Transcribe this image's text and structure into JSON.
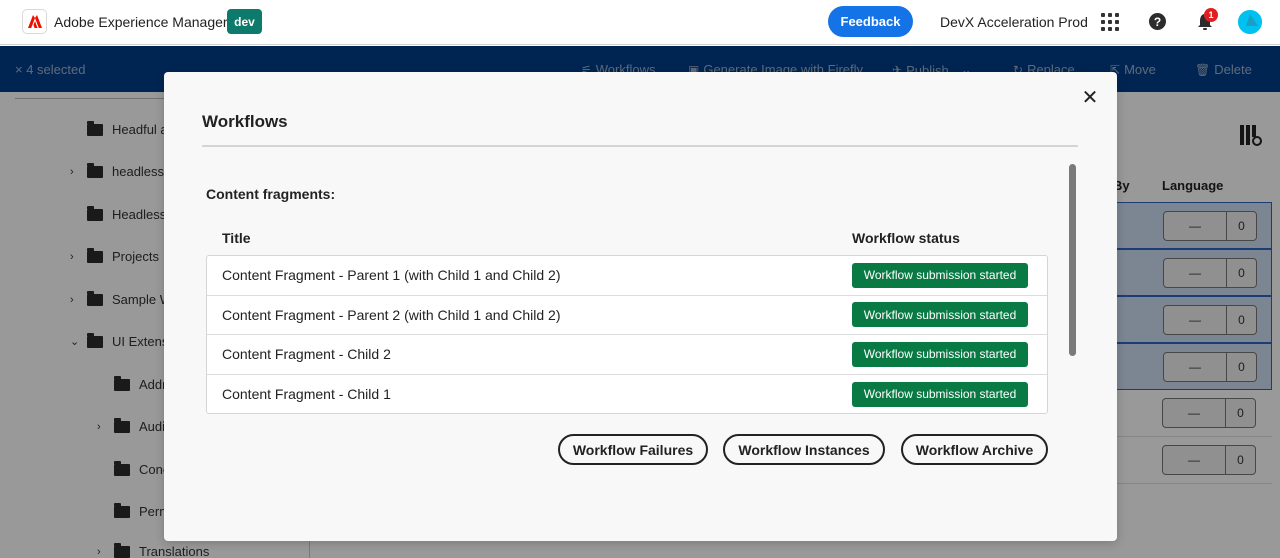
{
  "header": {
    "app_title": "Adobe Experience Manager",
    "env_badge": "dev",
    "feedback_label": "Feedback",
    "org_name": "DevX Acceleration Prod",
    "notification_count": "1",
    "help_glyph": "?"
  },
  "actionbar": {
    "selection_label": "× 4 selected",
    "actions": [
      {
        "label": "Workflows",
        "icon": "workflow-icon",
        "glyph": "⚟"
      },
      {
        "label": "Generate Image with Firefly",
        "icon": "image-icon",
        "glyph": "▣"
      },
      {
        "label": "Publish",
        "icon": "publish-icon",
        "glyph": "✈",
        "dropdown": "⌄"
      },
      {
        "label": "Replace",
        "icon": "replace-icon",
        "glyph": "↻"
      },
      {
        "label": "Move",
        "icon": "move-icon",
        "glyph": "⇱"
      },
      {
        "label": "Delete",
        "icon": "trash-icon",
        "glyph": "🗑"
      }
    ]
  },
  "sidebar": {
    "items": [
      {
        "label": "Headful a",
        "expandable": false
      },
      {
        "label": "headless",
        "expandable": true,
        "chevron": "›"
      },
      {
        "label": "Headless",
        "expandable": false
      },
      {
        "label": "Projects",
        "expandable": true,
        "chevron": "›"
      },
      {
        "label": "Sample W",
        "expandable": true,
        "chevron": "›"
      },
      {
        "label": "UI Extens",
        "expandable": true,
        "expanded": true,
        "chevron": "⌄"
      },
      {
        "label": "Addr",
        "expandable": false
      },
      {
        "label": "Audi",
        "expandable": true,
        "chevron": "›"
      },
      {
        "label": "Conc",
        "expandable": false
      },
      {
        "label": "Perm",
        "expandable": false
      },
      {
        "label": "Translations",
        "expandable": true,
        "chevron": "›"
      }
    ]
  },
  "background_table": {
    "columns": [
      "By",
      "Language"
    ],
    "rows": [
      {
        "language": "—",
        "count": "0",
        "selected": true
      },
      {
        "language": "—",
        "count": "0",
        "selected": true
      },
      {
        "language": "—",
        "count": "0",
        "selected": true
      },
      {
        "language": "—",
        "count": "0",
        "selected": true
      },
      {
        "language": "—",
        "count": "0",
        "selected": false
      },
      {
        "language": "—",
        "count": "0",
        "selected": false
      }
    ]
  },
  "modal": {
    "title": "Workflows",
    "close_glyph": "✕",
    "section_title": "Content fragments:",
    "columns": {
      "title": "Title",
      "status": "Workflow status"
    },
    "rows": [
      {
        "title": "Content Fragment - Parent 1 (with Child 1 and Child 2)",
        "status": "Workflow submission started"
      },
      {
        "title": "Content Fragment - Parent 2 (with Child 1 and Child 2)",
        "status": "Workflow submission started"
      },
      {
        "title": "Content Fragment - Child 2",
        "status": "Workflow submission started"
      },
      {
        "title": "Content Fragment - Child 1",
        "status": "Workflow submission started"
      }
    ],
    "buttons": [
      {
        "label": "Workflow Failures"
      },
      {
        "label": "Workflow Instances"
      },
      {
        "label": "Workflow Archive"
      }
    ]
  },
  "colors": {
    "brand_blue": "#1473e6",
    "actionbar": "#003e8a",
    "env_badge": "#0d7a6b",
    "status_green": "#0a7a45",
    "notif_red": "#e02020",
    "avatar": "#00c2f0"
  }
}
